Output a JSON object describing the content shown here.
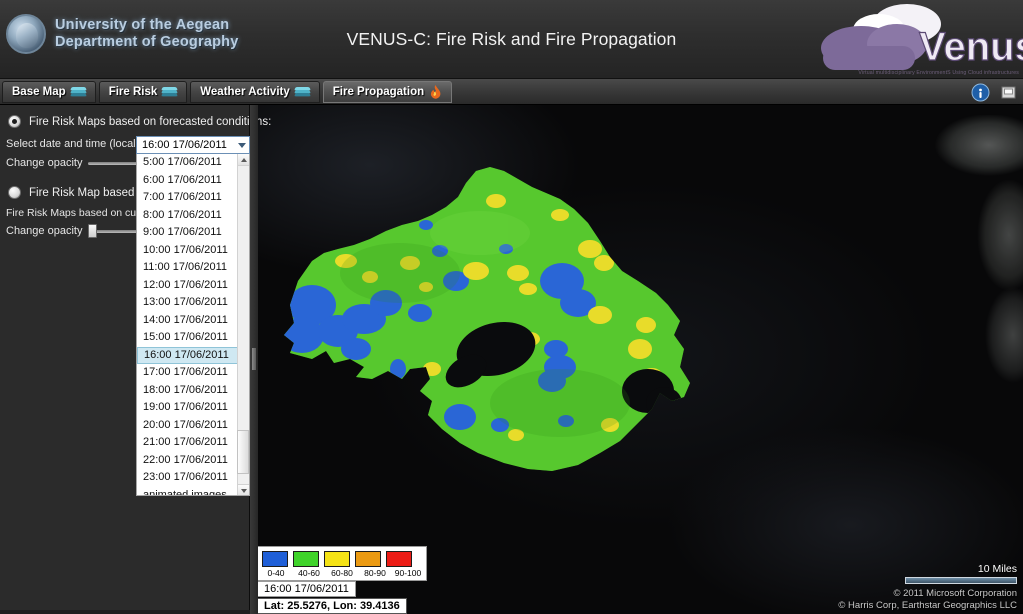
{
  "header": {
    "university_line1": "University of the Aegean",
    "university_line2": "Department of Geography",
    "seal_icon": "university-seal-icon",
    "app_title": "VENUS-C: Fire Risk and Fire Propagation",
    "logo_text": "Venus-C",
    "logo_tagline": "Virtual multidisciplinary EnvironmentS Using Cloud infrastructures"
  },
  "tabs": [
    {
      "label": "Base Map",
      "icon": "layers-icon",
      "active": false
    },
    {
      "label": "Fire Risk",
      "icon": "layers-icon",
      "active": false
    },
    {
      "label": "Weather Activity",
      "icon": "layers-icon",
      "active": false
    },
    {
      "label": "Fire Propagation",
      "icon": "flame-icon",
      "active": true
    }
  ],
  "toolbar_icons": [
    {
      "name": "info-icon",
      "glyph": "i"
    },
    {
      "name": "print-icon",
      "glyph": ""
    }
  ],
  "panel": {
    "section1": {
      "radio_label": "Fire Risk Maps based on forecasted conditions:",
      "selected": true,
      "datetime_label": "Select date and time (local time)",
      "opacity_label": "Change opacity",
      "opacity_value": 100
    },
    "section2": {
      "radio_label": "Fire Risk Map based on current conditions:",
      "selected": false,
      "info_label": "Fire Risk Maps based on current conditions",
      "opacity_label": "Change opacity",
      "opacity_value": 0
    }
  },
  "dropdown": {
    "selected": "16:00 17/06/2011",
    "open": true,
    "options": [
      "5:00 17/06/2011",
      "6:00 17/06/2011",
      "7:00 17/06/2011",
      "8:00 17/06/2011",
      "9:00 17/06/2011",
      "10:00 17/06/2011",
      "11:00 17/06/2011",
      "12:00 17/06/2011",
      "13:00 17/06/2011",
      "14:00 17/06/2011",
      "15:00 17/06/2011",
      "16:00 17/06/2011",
      "17:00 17/06/2011",
      "18:00 17/06/2011",
      "19:00 17/06/2011",
      "20:00 17/06/2011",
      "21:00 17/06/2011",
      "22:00 17/06/2011",
      "23:00 17/06/2011",
      "animated images"
    ]
  },
  "legend": {
    "items": [
      {
        "color": "#1f5fd8",
        "label": "0-40"
      },
      {
        "color": "#3fd32a",
        "label": "40-60"
      },
      {
        "color": "#f5e316",
        "label": "60-80"
      },
      {
        "color": "#eb9a12",
        "label": "80-90"
      },
      {
        "color": "#ec1c16",
        "label": "90-100"
      }
    ]
  },
  "map": {
    "timestamp": "16:00 17/06/2011",
    "coordinates": "Lat: 25.5276, Lon: 39.4136",
    "scale_label": "10 Miles",
    "attribution_line1": "© 2011 Microsoft Corporation",
    "attribution_line2": "© Harris Corp, Earthstar Geographics LLC"
  }
}
